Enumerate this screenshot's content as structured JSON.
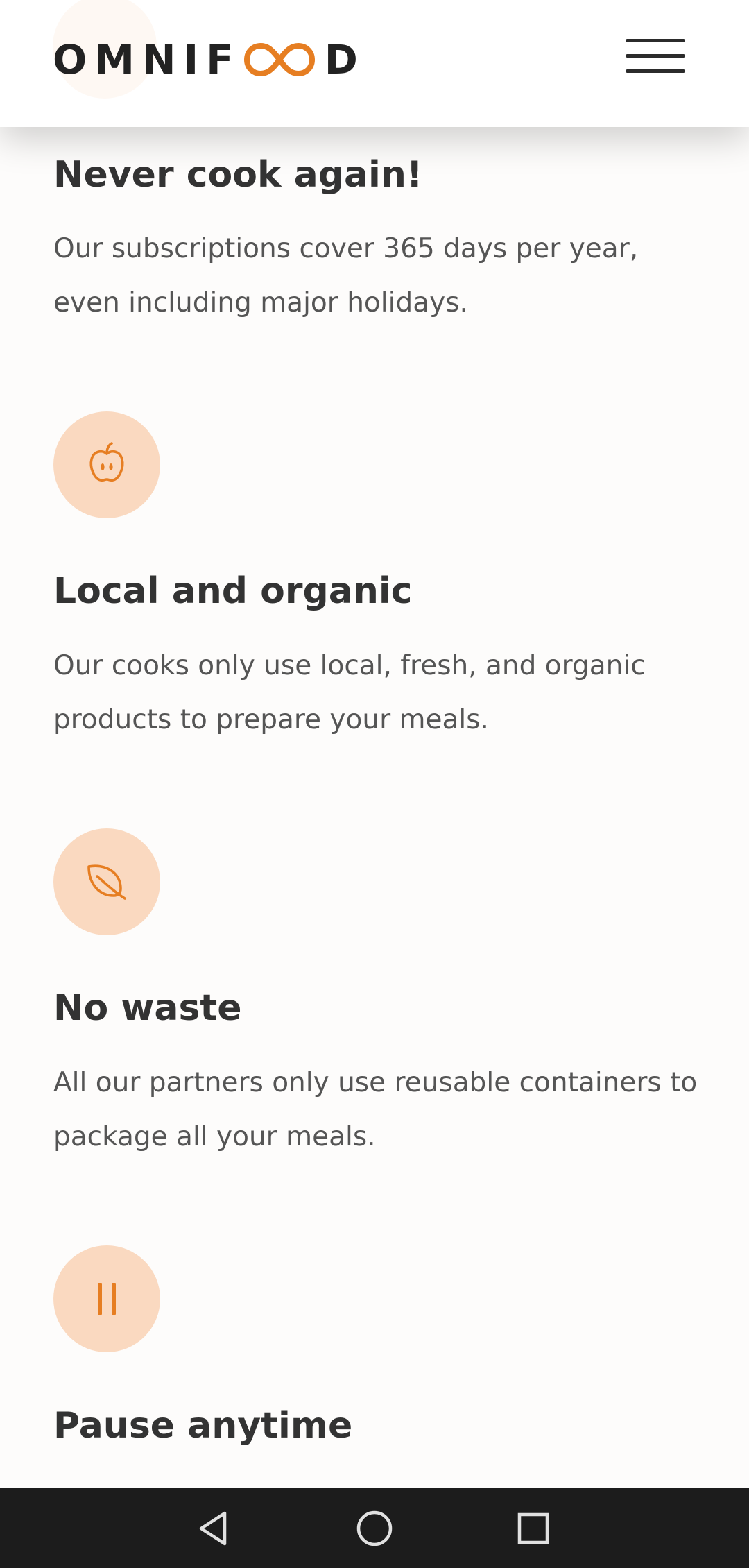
{
  "header": {
    "logo_text_before": "OMNIF",
    "logo_text_after": "D",
    "logo_accent_color": "#e67e22",
    "menu_icon": "hamburger-menu-icon"
  },
  "features": [
    {
      "title": "Never cook again!",
      "text": "Our subscriptions cover 365 days per year, even including major holidays."
    },
    {
      "icon": "apple-icon",
      "title": "Local and organic",
      "text": "Our cooks only use local, fresh, and organic products to prepare your meals."
    },
    {
      "icon": "leaf-icon",
      "title": "No waste",
      "text": "All our partners only use reusable containers to package all your meals."
    },
    {
      "icon": "pause-icon",
      "title": "Pause anytime"
    }
  ],
  "colors": {
    "accent": "#e67e22",
    "icon_background": "#fad9c0",
    "heading": "#333333",
    "body_text": "#555555",
    "nav_bar": "#1c1c1c"
  },
  "nav_bar": {
    "back_icon": "back-triangle-icon",
    "home_icon": "home-circle-icon",
    "recents_icon": "recents-square-icon"
  }
}
